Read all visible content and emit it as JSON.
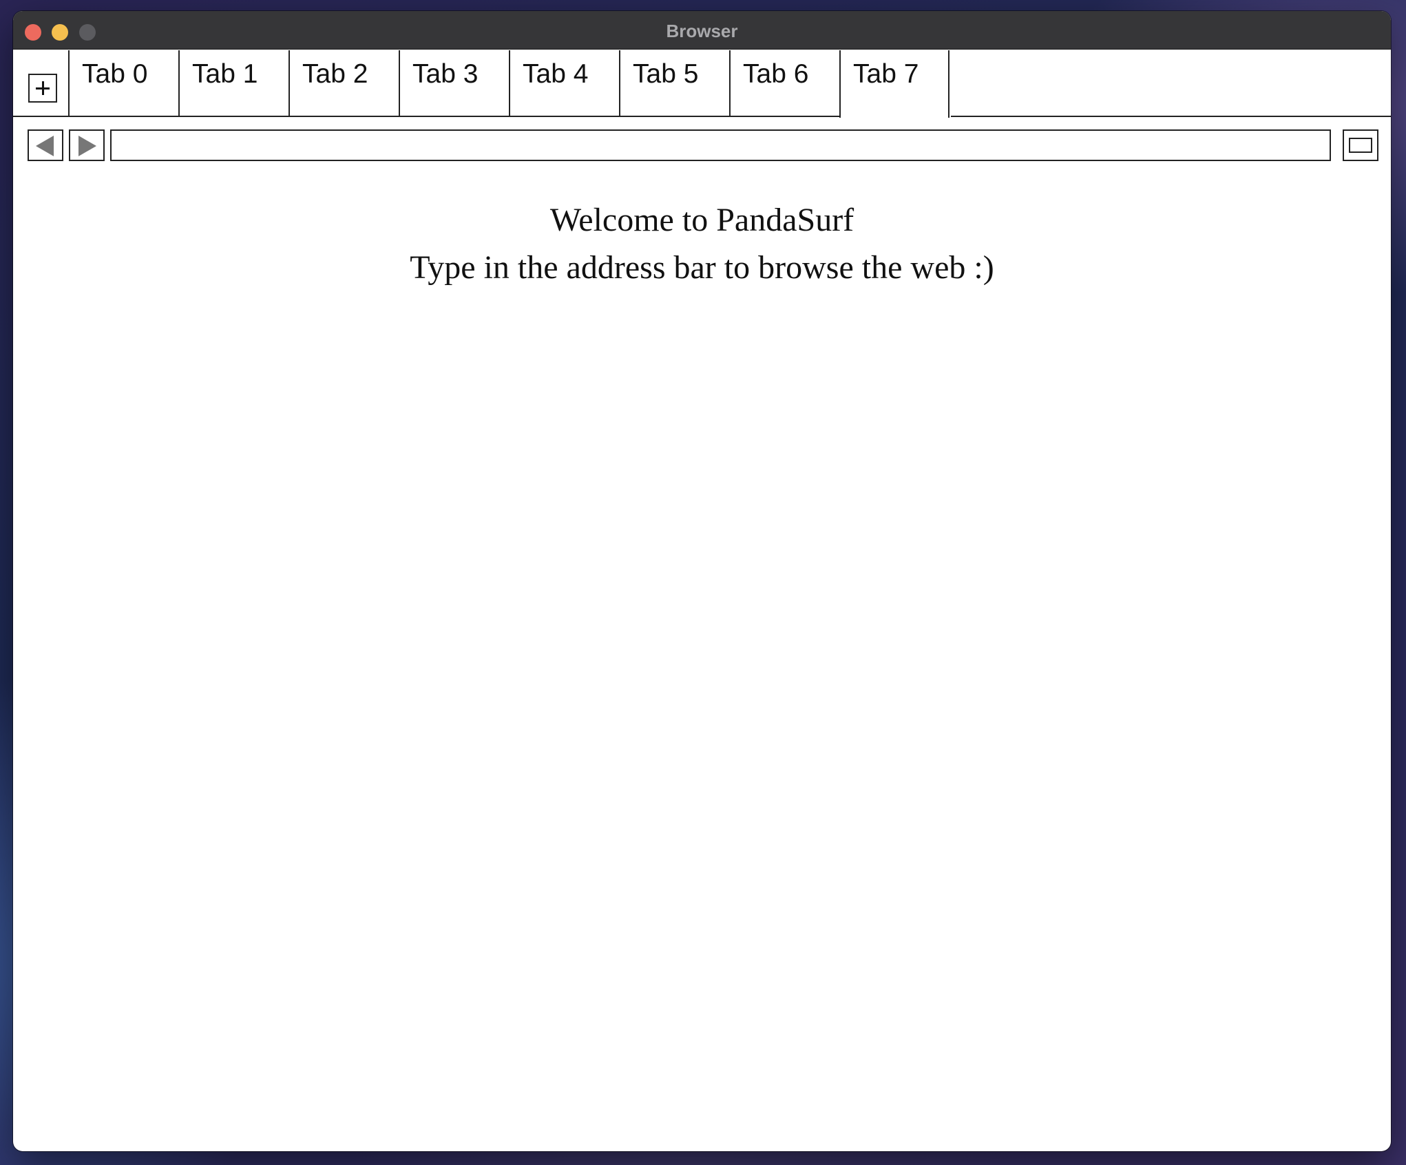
{
  "window": {
    "title": "Browser"
  },
  "tabs": [
    {
      "label": "Tab 0"
    },
    {
      "label": "Tab 1"
    },
    {
      "label": "Tab 2"
    },
    {
      "label": "Tab 3"
    },
    {
      "label": "Tab 4"
    },
    {
      "label": "Tab 5"
    },
    {
      "label": "Tab 6"
    },
    {
      "label": "Tab 7",
      "active": true
    }
  ],
  "toolbar": {
    "address_value": "",
    "back_icon": "back-arrow-icon",
    "forward_icon": "forward-arrow-icon",
    "new_tab_icon": "plus-icon",
    "fullscreen_icon": "fullscreen-icon"
  },
  "page": {
    "welcome": "Welcome to PandaSurf",
    "instructions": "Type in the address bar to browse the web :)"
  },
  "colors": {
    "close": "#ed6a5e",
    "minimize": "#f5bf4f",
    "maximize": "#5b5b5f",
    "titlebar": "#363638"
  }
}
